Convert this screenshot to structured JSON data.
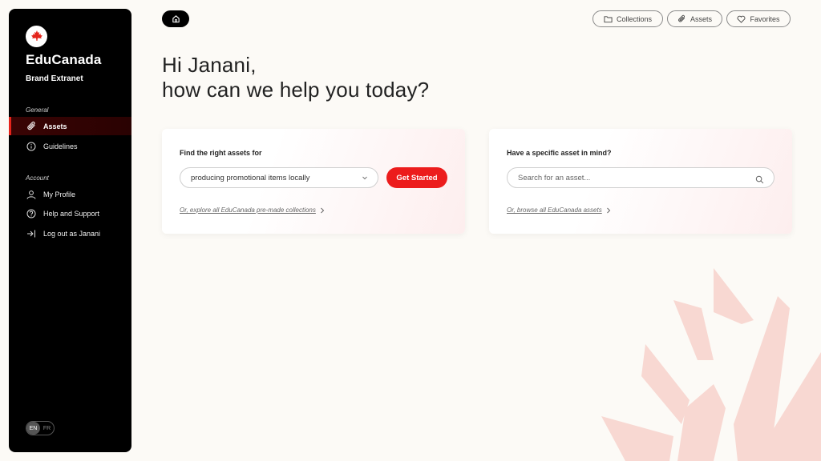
{
  "sidebar": {
    "brand_name": "EduCanada",
    "brand_sub": "Brand Extranet",
    "section_general": "General",
    "section_account": "Account",
    "general_items": [
      {
        "label": "Assets",
        "icon": "paperclip-icon",
        "active": true
      },
      {
        "label": "Guidelines",
        "icon": "info-icon",
        "active": false
      }
    ],
    "account_items": [
      {
        "label": "My Profile",
        "icon": "user-icon"
      },
      {
        "label": "Help and Support",
        "icon": "help-icon"
      },
      {
        "label": "Log out as Janani",
        "icon": "logout-icon"
      }
    ],
    "lang_en": "EN",
    "lang_fr": "FR"
  },
  "topbar": {
    "home_icon": "home-icon",
    "collections_label": "Collections",
    "assets_label": "Assets",
    "favorites_label": "Favorites"
  },
  "greeting": {
    "line1": "Hi Janani,",
    "line2": "how can we help you today?"
  },
  "find_card": {
    "title": "Find the right assets for",
    "select_value": "producing promotional items locally",
    "button_label": "Get Started",
    "link_text": "Or, explore all EduCanada pre-made collections"
  },
  "search_card": {
    "title": "Have a specific asset in mind?",
    "placeholder": "Search for an asset...",
    "link_text": "Or, browse all EduCanada assets"
  },
  "colors": {
    "accent": "#ec1c1c",
    "sidebar_bg": "#000000",
    "page_bg": "#fcfaf6"
  }
}
